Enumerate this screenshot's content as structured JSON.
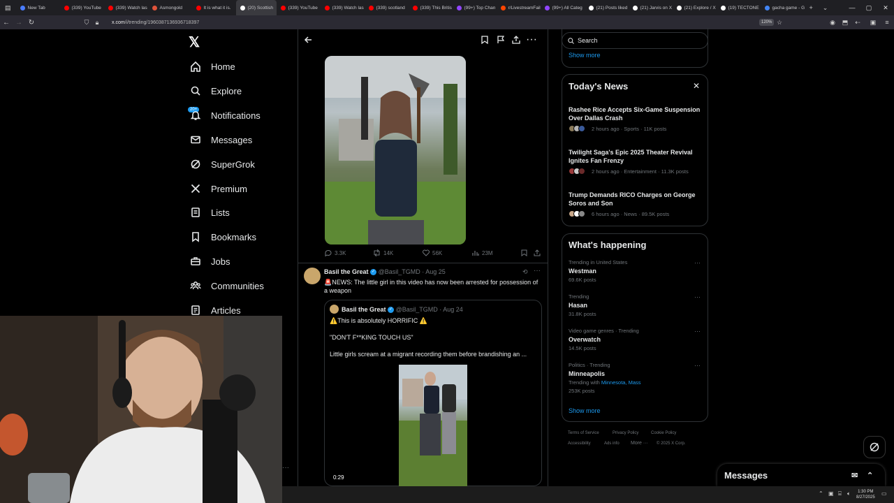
{
  "browser": {
    "tabs": [
      {
        "title": "New Tab",
        "color": "#4a7dff"
      },
      {
        "title": "(339) YouTube",
        "color": "#ff0000"
      },
      {
        "title": "(339) Watch las",
        "color": "#ff0000"
      },
      {
        "title": "Asmongold",
        "color": "#e0533a"
      },
      {
        "title": "It is what it is.",
        "color": "#ff0000"
      },
      {
        "title": "(20) Scottish",
        "color": "#ffffff",
        "active": true
      },
      {
        "title": "(339) YouTube",
        "color": "#ff0000"
      },
      {
        "title": "(339) Watch las",
        "color": "#ff0000"
      },
      {
        "title": "(339) scotland",
        "color": "#ff0000"
      },
      {
        "title": "(339) This Britis",
        "color": "#ff0000"
      },
      {
        "title": "(99+) Top Chan",
        "color": "#9146ff"
      },
      {
        "title": "r/LivestreamFail",
        "color": "#ff4500"
      },
      {
        "title": "(99+) All Categ",
        "color": "#9146ff"
      },
      {
        "title": "(21) Posts liked",
        "color": "#ffffff"
      },
      {
        "title": "(21) Jarvis on X",
        "color": "#ffffff"
      },
      {
        "title": "(21) Explore / X",
        "color": "#ffffff"
      },
      {
        "title": "(19) TECTONE",
        "color": "#ffffff"
      },
      {
        "title": "gacha game - G",
        "color": "#4285f4"
      }
    ],
    "url_host": "x.com",
    "url_path": "/i/trending/1960387136936718397",
    "zoom": "120%"
  },
  "sidebar": {
    "notif_badge": "20+",
    "items": [
      {
        "label": "Home",
        "icon": "home-icon"
      },
      {
        "label": "Explore",
        "icon": "search-icon"
      },
      {
        "label": "Notifications",
        "icon": "bell-icon"
      },
      {
        "label": "Messages",
        "icon": "envelope-icon"
      },
      {
        "label": "SuperGrok",
        "icon": "grok-icon"
      },
      {
        "label": "Premium",
        "icon": "x-logo-icon"
      },
      {
        "label": "Lists",
        "icon": "list-icon"
      },
      {
        "label": "Bookmarks",
        "icon": "bookmark-icon"
      },
      {
        "label": "Jobs",
        "icon": "briefcase-icon"
      },
      {
        "label": "Communities",
        "icon": "people-icon"
      },
      {
        "label": "Articles",
        "icon": "article-icon"
      }
    ]
  },
  "post": {
    "stats": {
      "replies": "3.3K",
      "reposts": "14K",
      "likes": "56K",
      "views": "23M"
    }
  },
  "reply": {
    "name": "Basil the Great",
    "handle": "@Basil_TGMD",
    "date": "· Aug 25",
    "emoji": "🚨",
    "text": "NEWS: The little girl in this video has now been arrested for possession of a weapon",
    "quote": {
      "name": "Basil the Great",
      "handle": "@Basil_TGMD",
      "date": "· Aug 24",
      "line1": "⚠️This is absolutely HORRIFIC ⚠️",
      "line2": "\"DON'T F**KING TOUCH US\"",
      "line3": "Little girls scream at a migrant recording them before brandishing an ...",
      "duration": "0:29"
    }
  },
  "right": {
    "search_placeholder": "Search",
    "show_more_top": "Show more",
    "news_title": "Today's News",
    "news": [
      {
        "title": "Rashee Rice Accepts Six-Game Suspension Over Dallas Crash",
        "meta": "2 hours ago · Sports · 11K posts"
      },
      {
        "title": "Twilight Saga's Epic 2025 Theater Revival Ignites Fan Frenzy",
        "meta": "2 hours ago · Entertainment · 11.3K posts"
      },
      {
        "title": "Trump Demands RICO Charges on George Soros and Son",
        "meta": "6 hours ago · News · 89.5K posts"
      }
    ],
    "happening_title": "What's happening",
    "trends": [
      {
        "category": "Trending in United States",
        "name": "Westman",
        "count": "69.6K posts"
      },
      {
        "category": "Trending",
        "name": "Hasan",
        "count": "31.8K posts"
      },
      {
        "category": "Video game genres · Trending",
        "name": "Overwatch",
        "count": "14.5K posts"
      },
      {
        "category": "Politics · Trending",
        "name": "Minneapolis",
        "with_label": "Trending with",
        "with_links": "Minnesota, Mass",
        "count": "253K posts"
      }
    ],
    "show_more": "Show more",
    "footer": [
      "Terms of Service",
      "Privacy Policy",
      "Cookie Policy",
      "Accessibility",
      "Ads info",
      "More ···",
      "© 2025 X Corp."
    ]
  },
  "messages_drawer": {
    "title": "Messages"
  },
  "taskbar": {
    "time": "1:30 PM",
    "date": "8/27/2025"
  }
}
